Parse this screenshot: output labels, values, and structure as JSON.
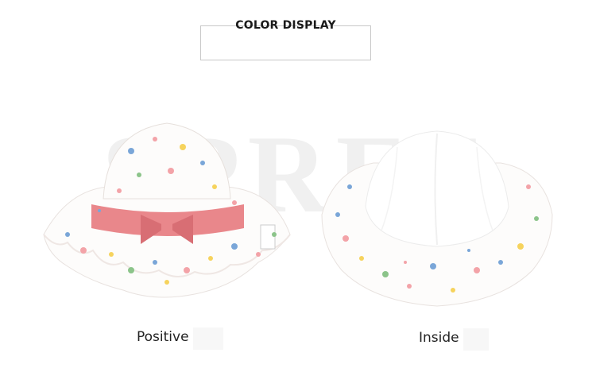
{
  "header": {
    "title": "COLOR DISPLAY"
  },
  "watermark": {
    "text": "SPRFE"
  },
  "captions": {
    "left": "Positive",
    "right": "Inside"
  },
  "colors": {
    "ribbon": "#e9878b",
    "ribbon_dark": "#d86e74",
    "fabric": "#fdfcfb",
    "inside_white": "#ffffff",
    "flower_blue": "#7aa6d8",
    "flower_pink": "#f3a3a8",
    "flower_yellow": "#f6d35d",
    "leaf_green": "#8cc48a",
    "watermark": "#f0f0f0"
  },
  "icons": {
    "left_image": "hat-front-icon",
    "right_image": "hat-inside-icon"
  }
}
